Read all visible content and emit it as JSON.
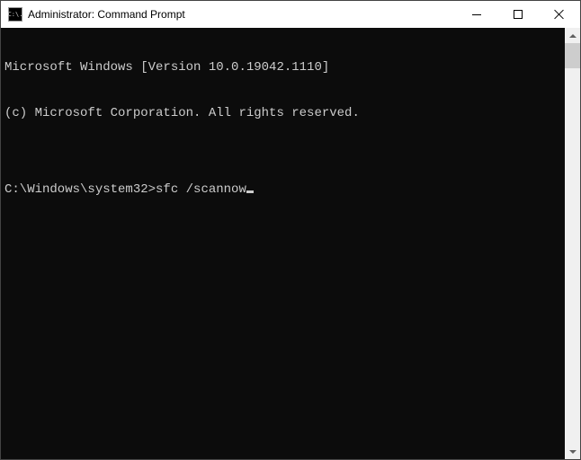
{
  "window": {
    "title": "Administrator: Command Prompt",
    "icon_text": "C:\\."
  },
  "console": {
    "line1": "Microsoft Windows [Version 10.0.19042.1110]",
    "line2": "(c) Microsoft Corporation. All rights reserved.",
    "blank": "",
    "prompt": "C:\\Windows\\system32>",
    "command": "sfc /scannow"
  }
}
